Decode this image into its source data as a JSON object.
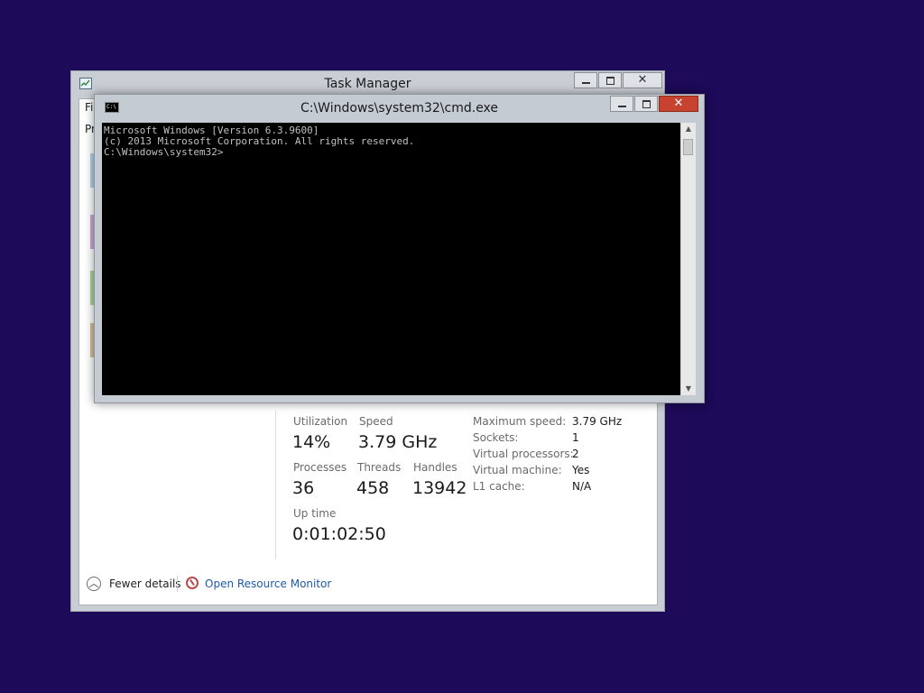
{
  "desktop": {
    "background": "#1d0a58"
  },
  "task_manager": {
    "title": "Task Manager",
    "menu_partial": "Fi",
    "tab_partial": "Pr",
    "stats": {
      "utilization_label": "Utilization",
      "utilization_value": "14%",
      "speed_label": "Speed",
      "speed_value": "3.79 GHz",
      "processes_label": "Processes",
      "processes_value": "36",
      "threads_label": "Threads",
      "threads_value": "458",
      "handles_label": "Handles",
      "handles_value": "13942",
      "uptime_label": "Up time",
      "uptime_value": "0:01:02:50"
    },
    "info": [
      {
        "key": "Maximum speed:",
        "value": "3.79 GHz"
      },
      {
        "key": "Sockets:",
        "value": "1"
      },
      {
        "key": "Virtual processors:",
        "value": "2"
      },
      {
        "key": "Virtual machine:",
        "value": "Yes"
      },
      {
        "key": "L1 cache:",
        "value": "N/A"
      }
    ],
    "footer": {
      "fewer_details": "Fewer details",
      "open_resource_monitor": "Open Resource Monitor",
      "link_color": "#1e5aa8"
    }
  },
  "cmd": {
    "title": "C:\\Windows\\system32\\cmd.exe",
    "icon_text": "C:\\",
    "lines": [
      "Microsoft Windows [Version 6.3.9600]",
      "(c) 2013 Microsoft Corporation. All rights reserved.",
      "C:\\Windows\\system32>"
    ]
  }
}
